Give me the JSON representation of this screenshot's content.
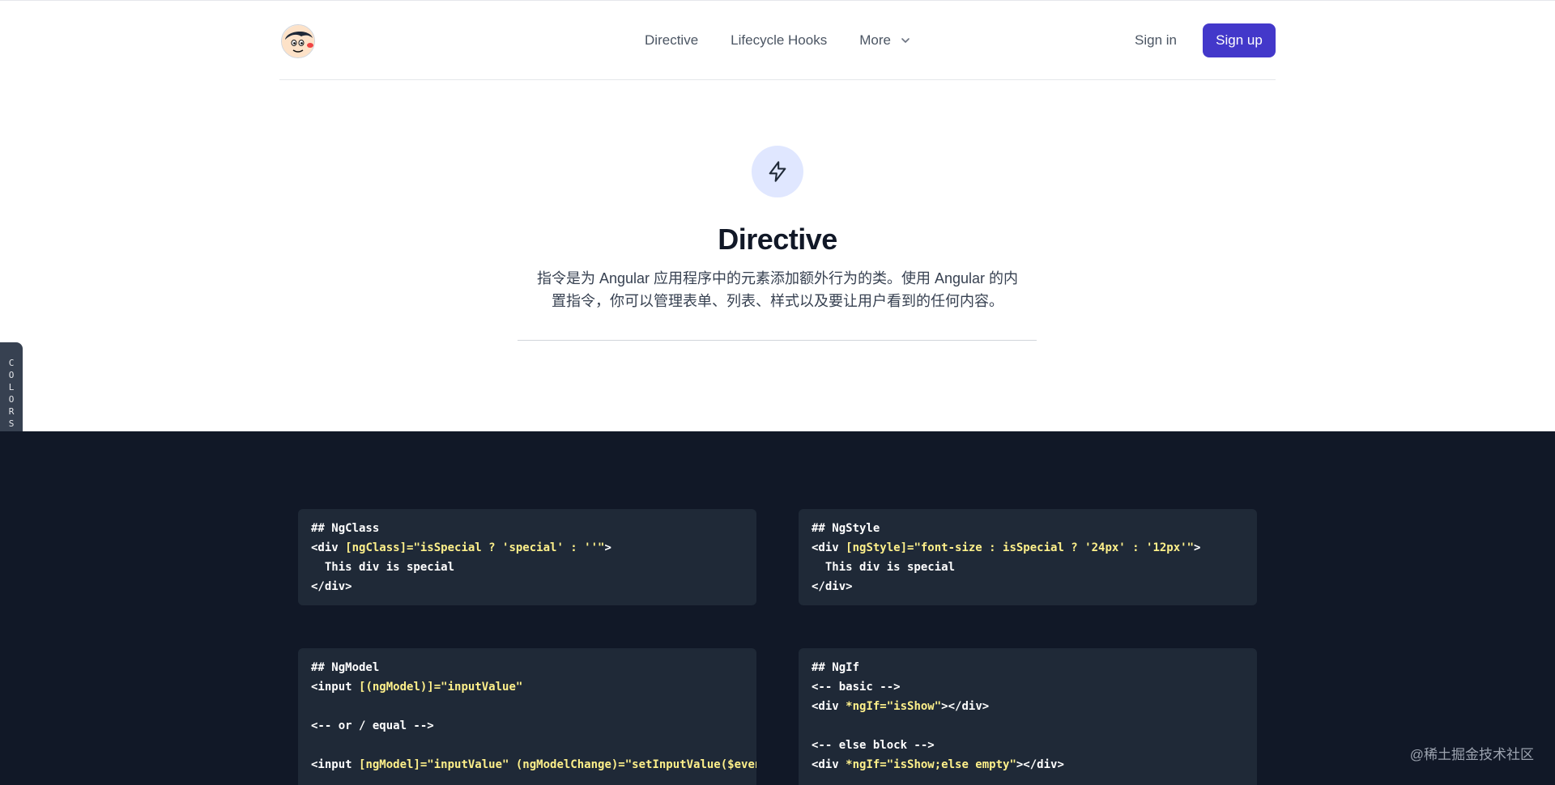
{
  "nav": {
    "links": [
      "Directive",
      "Lifecycle Hooks",
      "More"
    ],
    "signin": "Sign in",
    "signup": "Sign up"
  },
  "hero": {
    "title": "Directive",
    "desc_line1": "指令是为 Angular 应用程序中的元素添加额外行为的类。使用 Angular 的内",
    "desc_line2": "置指令，你可以管理表单、列表、样式以及要让用户看到的任何内容。"
  },
  "colors_tab": "COLORS",
  "cards": {
    "ngclass": {
      "l1": "## NgClass",
      "l2a": "<div ",
      "l2b": "[ngClass]=\"isSpecial ? 'special' : ''\"",
      "l2c": ">",
      "l3": "  This div is special",
      "l4": "</div>"
    },
    "ngstyle": {
      "l1": "## NgStyle",
      "l2a": "<div ",
      "l2b": "[ngStyle]=\"font-size : isSpecial ? '24px' : '12px'\"",
      "l2c": ">",
      "l3": "  This div is special",
      "l4": "</div>"
    },
    "ngmodel": {
      "l1": "## NgModel",
      "l2a": "<input ",
      "l2b": "[(ngModel)]=\"inputValue\"",
      "l3": "<-- or / equal -->",
      "l4a": "<input ",
      "l4b": "[ngModel]=\"inputValue\" (ngModelChange)=\"setInputValue($event)\""
    },
    "ngif": {
      "l1": "## NgIf",
      "l2": "<-- basic -->",
      "l3a": "<div ",
      "l3b": "*ngIf=\"isShow\"",
      "l3c": "></div>",
      "l4": "<-- else block -->",
      "l5a": "<div ",
      "l5b": "*ngIf=\"isShow;else empty\"",
      "l5c": "></div>"
    }
  },
  "watermark": "@稀土掘金技术社区",
  "colors": {
    "accent": "#4338ca",
    "dark_bg": "#111827",
    "card_bg": "#1f2937",
    "code_highlight": "#fef08a"
  }
}
